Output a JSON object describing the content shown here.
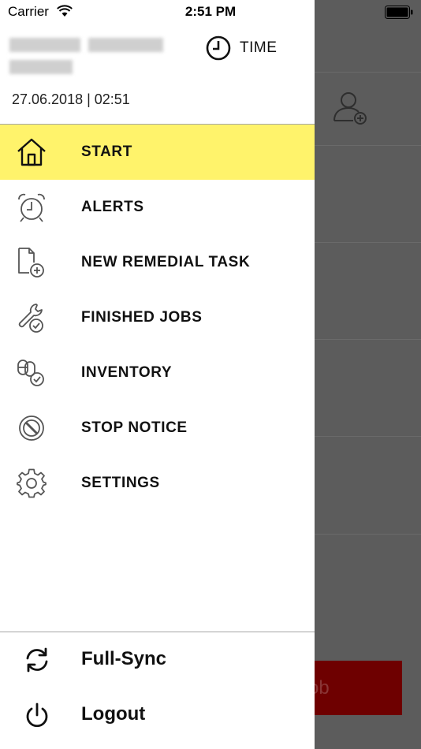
{
  "status_bar": {
    "carrier": "Carrier",
    "time": "2:51 PM"
  },
  "header": {
    "time_button_label": "TIME",
    "datetime": "27.06.2018 | 02:51"
  },
  "menu": {
    "items": [
      {
        "label": "START",
        "icon": "home-icon",
        "active": true
      },
      {
        "label": "ALERTS",
        "icon": "alarm-clock-icon"
      },
      {
        "label": "NEW REMEDIAL TASK",
        "icon": "add-document-icon"
      },
      {
        "label": "FINISHED JOBS",
        "icon": "wrench-check-icon"
      },
      {
        "label": "INVENTORY",
        "icon": "inventory-check-icon"
      },
      {
        "label": "STOP NOTICE",
        "icon": "stop-sign-icon"
      },
      {
        "label": "SETTINGS",
        "icon": "gear-icon"
      }
    ]
  },
  "footer": {
    "sync_label": "Full-Sync",
    "logout_label": "Logout"
  },
  "background": {
    "button_label": "ete Job"
  },
  "colors": {
    "active_item": "#fff36b",
    "background_button": "#6e0000",
    "overlay": "#5c5c5c"
  }
}
